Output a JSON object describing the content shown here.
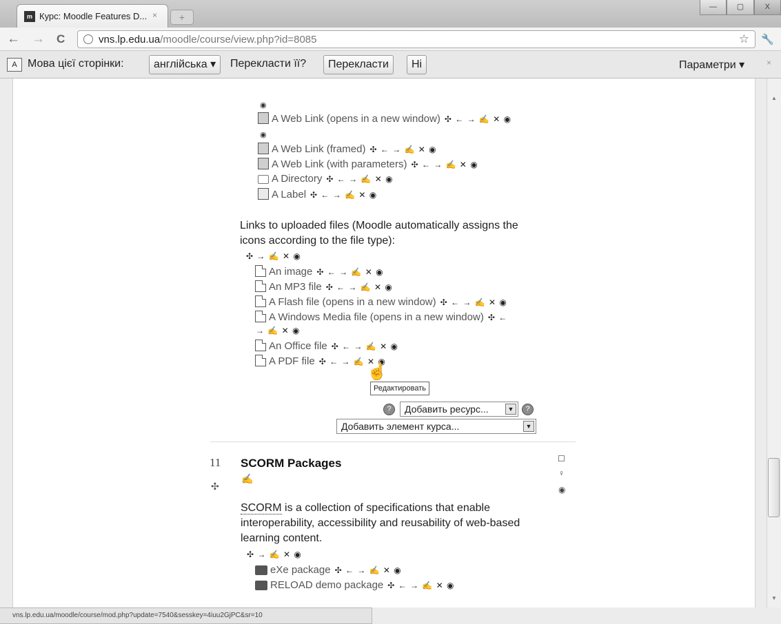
{
  "browser": {
    "tab_title": "Курс: Moodle Features D...",
    "tab_favicon": "m",
    "tab_close": "×",
    "new_tab": "+",
    "window_controls": {
      "minimize": "—",
      "maximize": "▢",
      "close": "X"
    },
    "back": "←",
    "forward": "→",
    "reload": "C",
    "url_domain": "vns.lp.edu.ua",
    "url_path": "/moodle/course/view.php?id=8085",
    "bookmark_star": "☆",
    "wrench": "🔧"
  },
  "translate_bar": {
    "icon": "A",
    "language_label": "Мова цієї сторінки:",
    "language_value": "англійська ▾",
    "question": "Перекласти її?",
    "translate_button": "Перекласти",
    "no_button": "Ні",
    "options": "Параметри ▾",
    "close": "×"
  },
  "controls": {
    "full": "✣ ← → ✍ ✕ ◉",
    "move_right": "✣ → ✍ ✕ ◉",
    "eye": "◉",
    "split_first": "✣ ←",
    "split_second": "→ ✍ ✕ ◉"
  },
  "resources": [
    {
      "label": "A Web Link (opens in a new window)"
    },
    {
      "label": "A Web Link (framed)"
    },
    {
      "label": "A Web Link (with parameters)"
    },
    {
      "label": "A Directory"
    },
    {
      "label": "A Label"
    }
  ],
  "uploaded_intro": [
    "Links to uploaded files (Moodle automatically assigns the",
    "icons according to the file type):"
  ],
  "files": [
    {
      "label": "An image"
    },
    {
      "label": "An MP3 file"
    },
    {
      "label": "A Flash file (opens in a new window)"
    },
    {
      "label": "A Windows Media file (opens in a new window)"
    },
    {
      "label": "An Office file"
    },
    {
      "label": "A PDF file"
    }
  ],
  "tooltip": "Редактировать",
  "add_resource": "Добавить ресурс...",
  "add_activity": "Добавить элемент курса...",
  "help_icon": "?",
  "select_arrow": "▼",
  "section": {
    "number": "11",
    "move": "✣",
    "title": "SCORM Packages",
    "edit": "✍",
    "side_checkbox": "☐",
    "side_bulb": "♀",
    "side_eye": "◉",
    "abbr": "SCORM",
    "summary_rest": " is a collection of specifications that enable",
    "summary_lines": [
      "interoperability, accessibility and reusability of web-based",
      "learning content."
    ],
    "packages": [
      {
        "label": "eXe package"
      },
      {
        "label": "RELOAD demo package"
      }
    ]
  },
  "status_url": "vns.lp.edu.ua/moodle/course/mod.php?update=7540&sesskey=4iuu2GjPC&sr=10"
}
